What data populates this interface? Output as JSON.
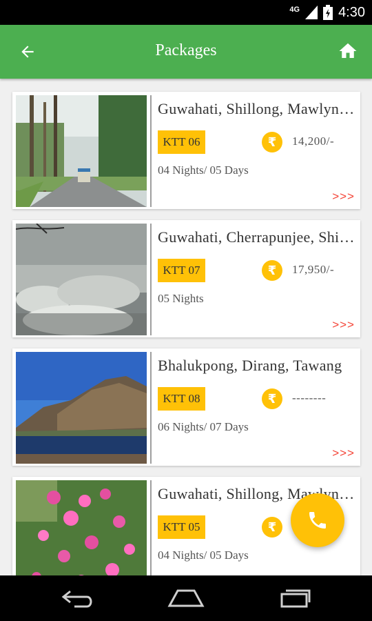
{
  "status_bar": {
    "network": "4G",
    "time": "4:30"
  },
  "app_bar": {
    "title": "Packages",
    "back_icon": "arrow-back-icon",
    "home_icon": "home-icon"
  },
  "colors": {
    "primary": "#4caf50",
    "accent": "#ffc107",
    "more_link": "#f44336"
  },
  "packages": [
    {
      "destinations": "Guwahati, Shillong, Mawlynnong",
      "code": "KTT 06",
      "price": "14,200/-",
      "duration": "04 Nights/ 05 Days",
      "more": ">>>",
      "image": "forest-road"
    },
    {
      "destinations": "Guwahati, Cherrapunjee, Shillong",
      "code": "KTT 07",
      "price": "17,950/-",
      "duration": "05 Nights",
      "more": ">>>",
      "image": "waterfall"
    },
    {
      "destinations": "Bhalukpong, Dirang, Tawang",
      "code": "KTT 08",
      "price": "--------",
      "duration": "06 Nights/ 07 Days",
      "more": ">>>",
      "image": "mountain-lake"
    },
    {
      "destinations": "Guwahati, Shillong, Mawlynnong",
      "code": "KTT 05",
      "price": "",
      "duration": "04 Nights/ 05 Days",
      "more": ">>>",
      "image": "pink-flowers"
    }
  ],
  "rupee_symbol": "₹",
  "fab": {
    "icon": "phone-icon"
  },
  "nav_bar": {
    "back_icon": "nav-back-icon",
    "home_icon": "nav-home-icon",
    "recents_icon": "nav-recents-icon"
  }
}
